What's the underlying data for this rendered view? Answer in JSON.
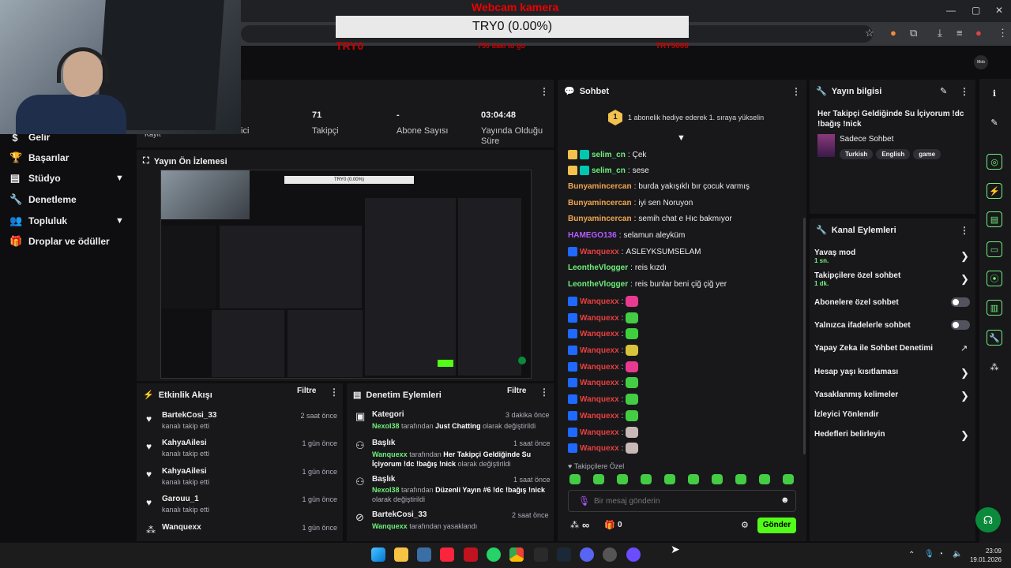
{
  "overlay": {
    "title": "Webcam kamera",
    "box_text": "TRY0 (0.00%)",
    "left_red": "TRY0",
    "mid_red": "750 daki to go",
    "right_red": "TRY5000"
  },
  "profile_short": "Mob",
  "nav": {
    "items": [
      {
        "label": "Gelir"
      },
      {
        "label": "Başarılar"
      },
      {
        "label": "Stüdyo"
      },
      {
        "label": "Denetleme"
      },
      {
        "label": "Topluluk"
      },
      {
        "label": "Droplar ve ödüller"
      }
    ]
  },
  "stats": {
    "cut_label_1": "Kayıt",
    "cut_label_2": "ici",
    "followers_value": "71",
    "followers_label": "Takipçi",
    "subs_value": "-",
    "subs_label": "Abone Sayısı",
    "uptime_value": "03:04:48",
    "uptime_label": "Yayında Olduğu Süre"
  },
  "preview": {
    "title": "Yayın Ön İzlemesi",
    "inner_box": "TRY0 (0.00%)"
  },
  "activity": {
    "title": "Etkinlik Akışı",
    "filter": "Filtre",
    "items": [
      {
        "name": "BartekCosi_33",
        "sub": "kanalı takip etti",
        "time": "2 saat önce"
      },
      {
        "name": "KahyaAilesi",
        "sub": "kanalı takip etti",
        "time": "1 gün önce"
      },
      {
        "name": "KahyaAilesi",
        "sub": "kanalı takip etti",
        "time": "1 gün önce"
      },
      {
        "name": "Garouu_1",
        "sub": "kanalı takip etti",
        "time": "1 gün önce"
      },
      {
        "name": "Wanquexx",
        "sub": "",
        "time": "1 gün önce"
      }
    ]
  },
  "moderation": {
    "title": "Denetim Eylemleri",
    "filter": "Filtre",
    "items": [
      {
        "title": "Kategori",
        "user": "Nexol38",
        "mid": "tarafından",
        "value": "Just Chatting",
        "end": "olarak değiştirildi",
        "time": "3 dakika önce"
      },
      {
        "title": "Başlık",
        "user": "Wanquexx",
        "mid": "tarafından",
        "value": "Her Takipçi Geldiğinde Su İçiyorum !dc !bağış !nick",
        "end": "olarak değiştirildi",
        "time": "1 saat önce"
      },
      {
        "title": "Başlık",
        "user": "Nexol38",
        "mid": "tarafından",
        "value": "Düzenli Yayın #6 !dc !bağış !nick",
        "end": "olarak değiştirildi",
        "time": "1 saat önce"
      },
      {
        "title": "BartekCosi_33",
        "user": "Wanquexx",
        "mid": "tarafından yasaklandı",
        "value": "",
        "end": "",
        "time": "2 saat önce"
      }
    ]
  },
  "chat": {
    "title": "Sohbet",
    "banner": "1 abonelik hediye ederek 1. sıraya yükselin",
    "banner_num": "1",
    "messages": [
      {
        "user": "selim_cn",
        "text": "Çek",
        "color": "#6ff07a"
      },
      {
        "user": "selim_cn",
        "text": "sese",
        "color": "#6ff07a"
      },
      {
        "user": "Bunyamincercan",
        "text": "burda yakışıklı bır çocuk varmış",
        "color": "#f2a64e"
      },
      {
        "user": "Bunyamincercan",
        "text": "iyi sen Noruyon",
        "color": "#f2a64e"
      },
      {
        "user": "Bunyamincercan",
        "text": "semih chat e Hıc bakmıyor",
        "color": "#f2a64e"
      },
      {
        "user": "HAMEGO136",
        "text": "selamun aleyküm",
        "color": "#b45cff"
      },
      {
        "user": "Wanquexx",
        "text": "ASLEYKSUMSELAM",
        "color": "#e8403f"
      },
      {
        "user": "LeontheVlogger",
        "text": "reis kızdı",
        "color": "#6ff07a"
      },
      {
        "user": "LeontheVlogger",
        "text": "reis bunlar beni çiğ çiğ yer",
        "color": "#6ff07a"
      }
    ],
    "emote_user": "Wanquexx",
    "emote_rows": 10,
    "followers_only": "Takipçilere Özel",
    "input_placeholder": "Bir mesaj gönderin",
    "points": "∞",
    "gift_count": "0",
    "send": "Gönder"
  },
  "stream_info": {
    "title": "Yayın bilgisi",
    "stream_title": "Her Takipçi Geldiğinde Su İçiyorum !dc !bağış !nick",
    "category": "Sadece Sohbet",
    "tags": [
      "Turkish",
      "English",
      "game"
    ]
  },
  "channel_actions": {
    "title": "Kanal Eylemleri",
    "items": [
      {
        "label": "Yavaş mod",
        "sub": "1 sn."
      },
      {
        "label": "Takipçilere özel sohbet",
        "sub": "1 dk."
      },
      {
        "label": "Abonelere özel sohbet",
        "sub": ""
      },
      {
        "label": "Yalnızca ifadelerle sohbet",
        "sub": ""
      },
      {
        "label": "Yapay Zeka ile Sohbet Denetimi",
        "sub": ""
      },
      {
        "label": "Hesap yaşı kısıtlaması",
        "sub": ""
      },
      {
        "label": "Yasaklanmış kelimeler",
        "sub": ""
      },
      {
        "label": "İzleyici Yönlendir",
        "sub": ""
      },
      {
        "label": "Hedefleri belirleyin",
        "sub": ""
      }
    ]
  },
  "taskbar": {
    "time": "23:09",
    "date": "19.01.2026"
  },
  "colors": {
    "accent_green": "#53fc18",
    "panel": "#18181b",
    "bg": "#0e0e10"
  }
}
